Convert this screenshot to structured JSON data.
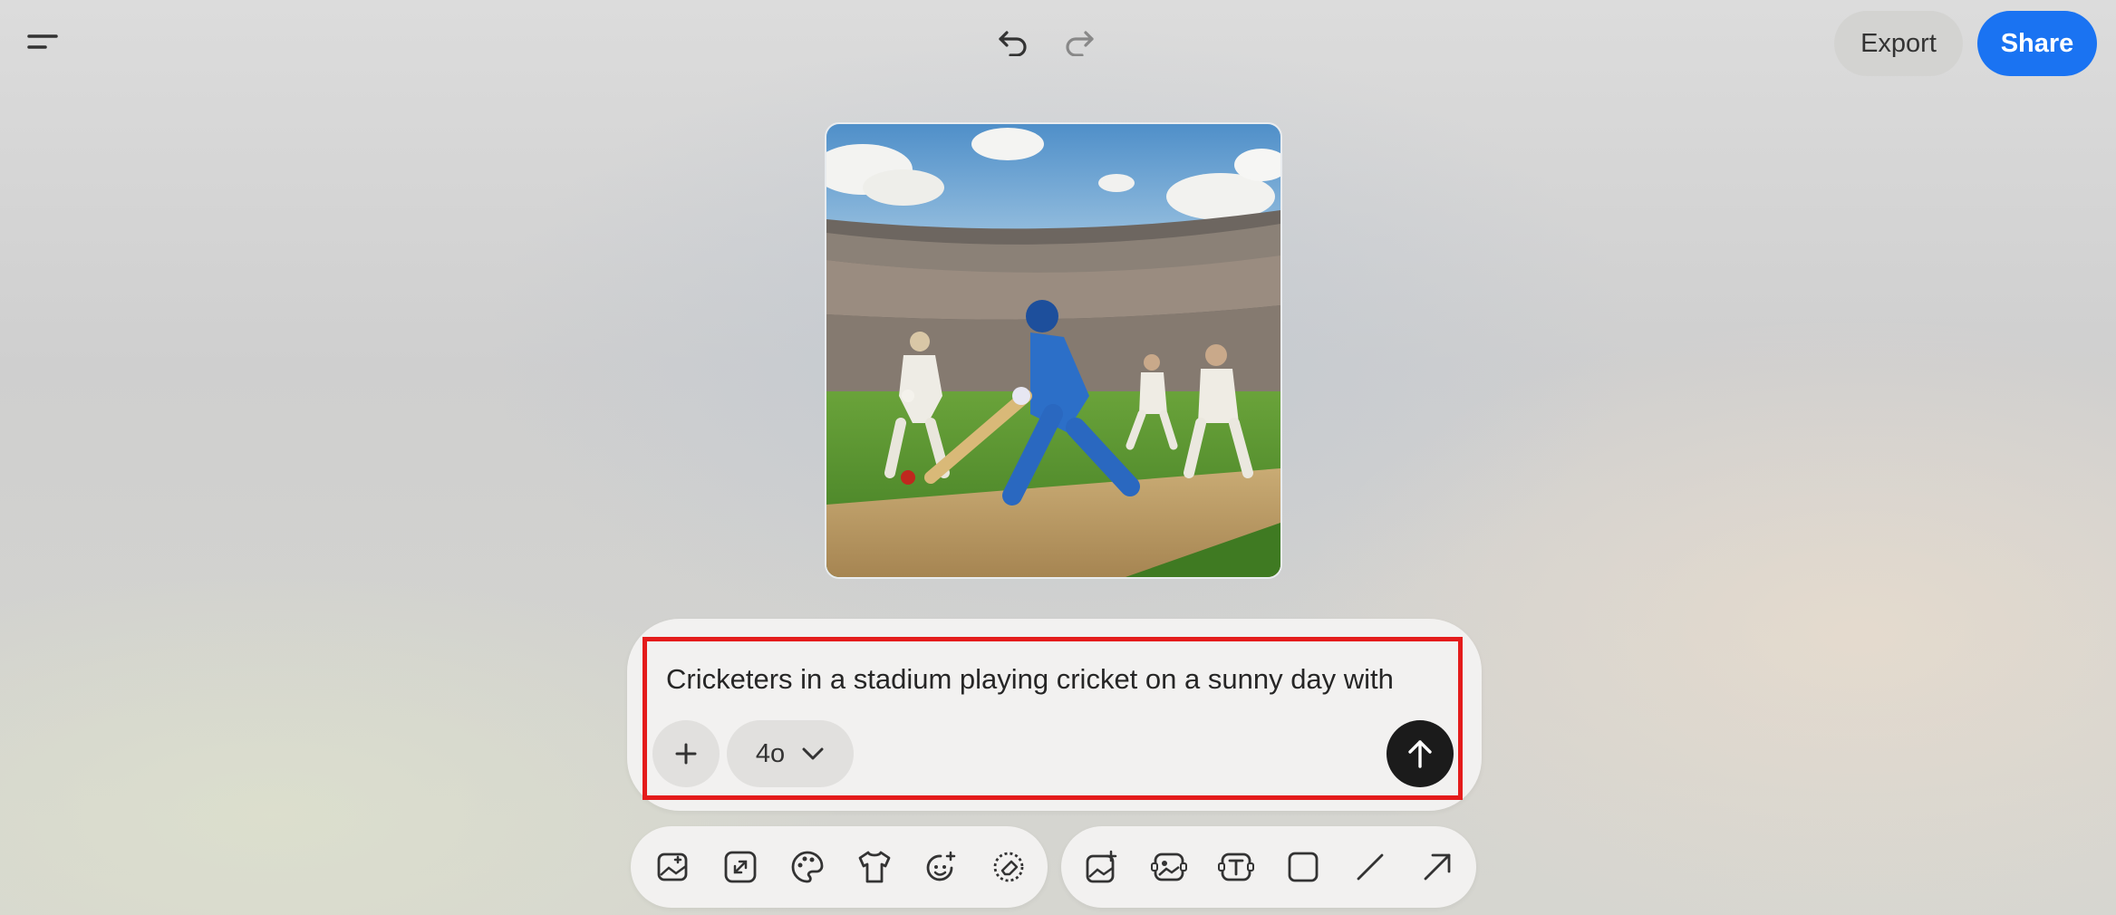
{
  "header": {
    "menu_icon": "menu-icon",
    "undo_icon": "undo-icon",
    "redo_icon": "redo-icon",
    "export_label": "Export",
    "share_label": "Share"
  },
  "canvas": {
    "image_subject": "cricket-stadium-image"
  },
  "prompt": {
    "text": "Cricketers in a stadium playing cricket on a sunny day with",
    "add_icon": "plus-icon",
    "model_label": "4o",
    "model_icon": "chevron-down-icon",
    "send_icon": "arrow-up-icon"
  },
  "toolbar_left": [
    "add-image-icon",
    "expand-icon",
    "palette-icon",
    "shirt-icon",
    "face-sparkle-icon",
    "eraser-icon"
  ],
  "toolbar_right": [
    "image-sparkle-icon",
    "image-edit-icon",
    "text-box-icon",
    "square-icon",
    "line-icon",
    "arrow-icon"
  ],
  "colors": {
    "accent": "#1a73f2",
    "highlight": "#e41b1b",
    "send": "#1b1b1b"
  }
}
